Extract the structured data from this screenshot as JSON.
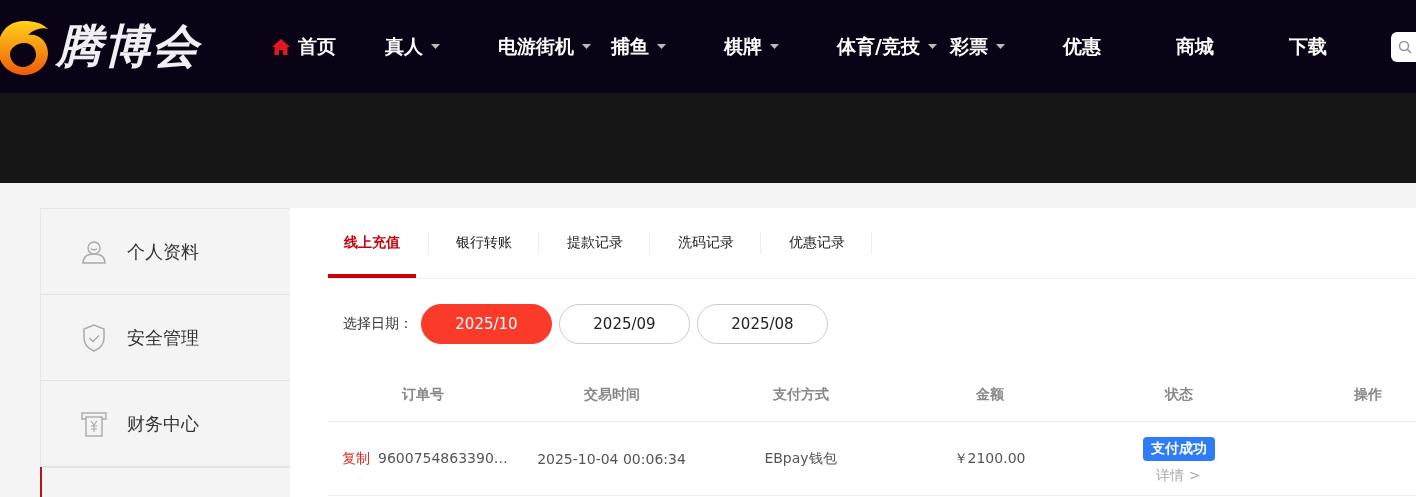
{
  "logo": {
    "text": "腾博会"
  },
  "nav": [
    {
      "label": "首页",
      "has_menu": false
    },
    {
      "label": "真人",
      "has_menu": true
    },
    {
      "label": "电游街机",
      "has_menu": true
    },
    {
      "label": "捕鱼",
      "has_menu": true
    },
    {
      "label": "棋牌",
      "has_menu": true
    },
    {
      "label": "体育/竞技",
      "has_menu": true
    },
    {
      "label": "彩票",
      "has_menu": true
    },
    {
      "label": "优惠",
      "has_menu": false
    },
    {
      "label": "商城",
      "has_menu": false
    },
    {
      "label": "下载",
      "has_menu": false
    }
  ],
  "sidebar": {
    "items": [
      {
        "label": "个人资料"
      },
      {
        "label": "安全管理"
      },
      {
        "label": "财务中心"
      }
    ]
  },
  "tabs": [
    {
      "label": "线上充值",
      "selected": true
    },
    {
      "label": "银行转账",
      "selected": false
    },
    {
      "label": "提款记录",
      "selected": false
    },
    {
      "label": "洗码记录",
      "selected": false
    },
    {
      "label": "优惠记录",
      "selected": false
    }
  ],
  "date_filter": {
    "label": "选择日期：",
    "options": [
      {
        "label": "2025/10",
        "selected": true
      },
      {
        "label": "2025/09",
        "selected": false
      },
      {
        "label": "2025/08",
        "selected": false
      }
    ]
  },
  "table": {
    "columns": [
      "订单号",
      "交易时间",
      "支付方式",
      "金额",
      "状态",
      "操作"
    ],
    "rows": [
      {
        "copy_link": "复制",
        "order_no": "9600754863390…",
        "time": "2025-10-04 00:06:34",
        "method": "EBpay钱包",
        "amount": "￥2100.00",
        "status": "支付成功",
        "details_link": "详情 >"
      }
    ]
  }
}
